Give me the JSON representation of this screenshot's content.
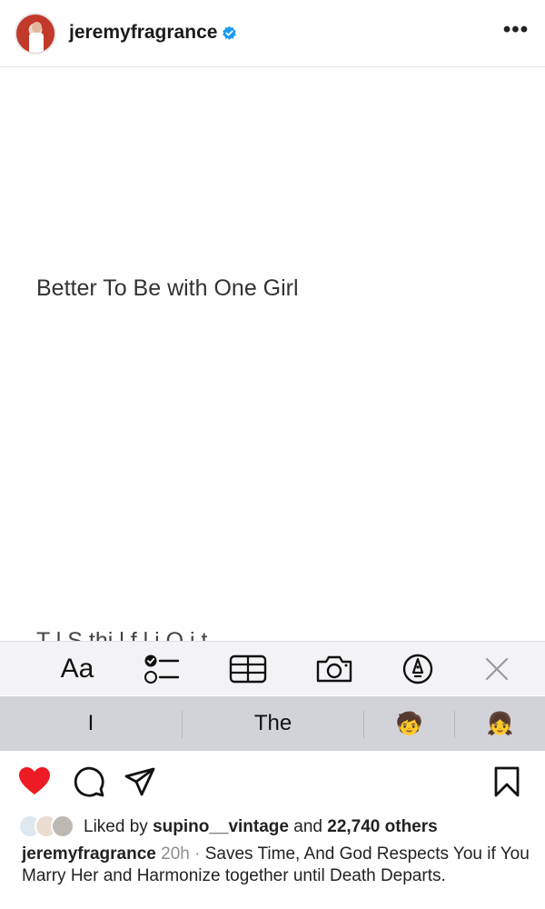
{
  "header": {
    "username": "jeremyfragrance",
    "verified_icon": "verified-badge-icon",
    "more_label": "•••"
  },
  "note": {
    "line1": "Better To Be with One Girl",
    "line2_partial": "T  l  S   thi        l  f  l i  O  i    t"
  },
  "toolbar": {
    "format_label": "Aa",
    "icons": [
      "checklist-icon",
      "table-icon",
      "camera-icon",
      "markup-icon",
      "close-icon"
    ]
  },
  "predictive": {
    "suggestions": [
      "I",
      "The",
      "🧒",
      "👧"
    ]
  },
  "actions": {
    "icons": [
      "heart-filled-icon",
      "comment-icon",
      "share-icon",
      "bookmark-icon"
    ],
    "like_color": "#ed1b24"
  },
  "likes": {
    "prefix": "Liked by",
    "user": "supino__vintage",
    "middle": "and",
    "count": "22,740 others"
  },
  "caption": {
    "username": "jeremyfragrance",
    "time": "20h",
    "separator": "·",
    "text": "Saves Time, And God Respects You if You Marry Her and Harmonize together until Death Departs."
  }
}
